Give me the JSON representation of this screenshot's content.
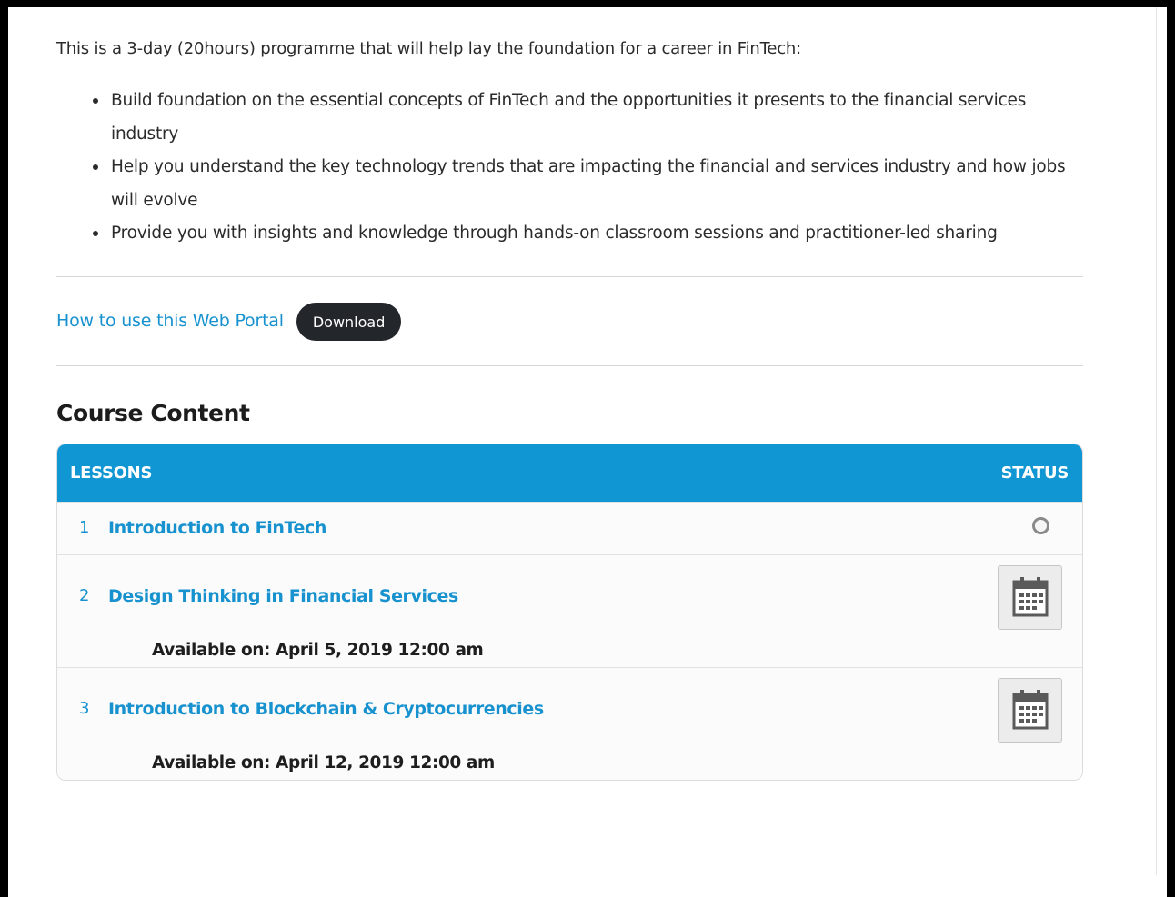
{
  "intro": {
    "text": "This is a 3-day (20hours) programme that will help lay the foundation for a career in FinTech:",
    "bullets": [
      "Build foundation on the essential concepts of FinTech and the opportunities it presents to the financial services industry",
      "Help you understand the key technology trends that are impacting the financial and services industry and how jobs will evolve",
      "Provide you with insights and knowledge through hands-on classroom sessions and practitioner-led sharing"
    ]
  },
  "portal": {
    "link_label": "How to use this Web Portal",
    "download_label": "Download"
  },
  "course": {
    "section_title": "Course Content",
    "headers": {
      "lessons": "LESSONS",
      "status": "STATUS"
    },
    "lessons": [
      {
        "number": "1",
        "title": "Introduction to FinTech",
        "status_icon": "circle-outline-icon"
      },
      {
        "number": "2",
        "title": "Design Thinking in Financial Services",
        "status_icon": "calendar-icon",
        "available": "Available on: April 5, 2019 12:00 am"
      },
      {
        "number": "3",
        "title": "Introduction to Blockchain & Cryptocurrencies",
        "status_icon": "calendar-icon",
        "available": "Available on: April 12, 2019 12:00 am"
      }
    ]
  },
  "colors": {
    "accent": "#1196d4",
    "link": "#1792cf",
    "button_dark": "#23262b",
    "status_gray": "#8a8a8a"
  }
}
